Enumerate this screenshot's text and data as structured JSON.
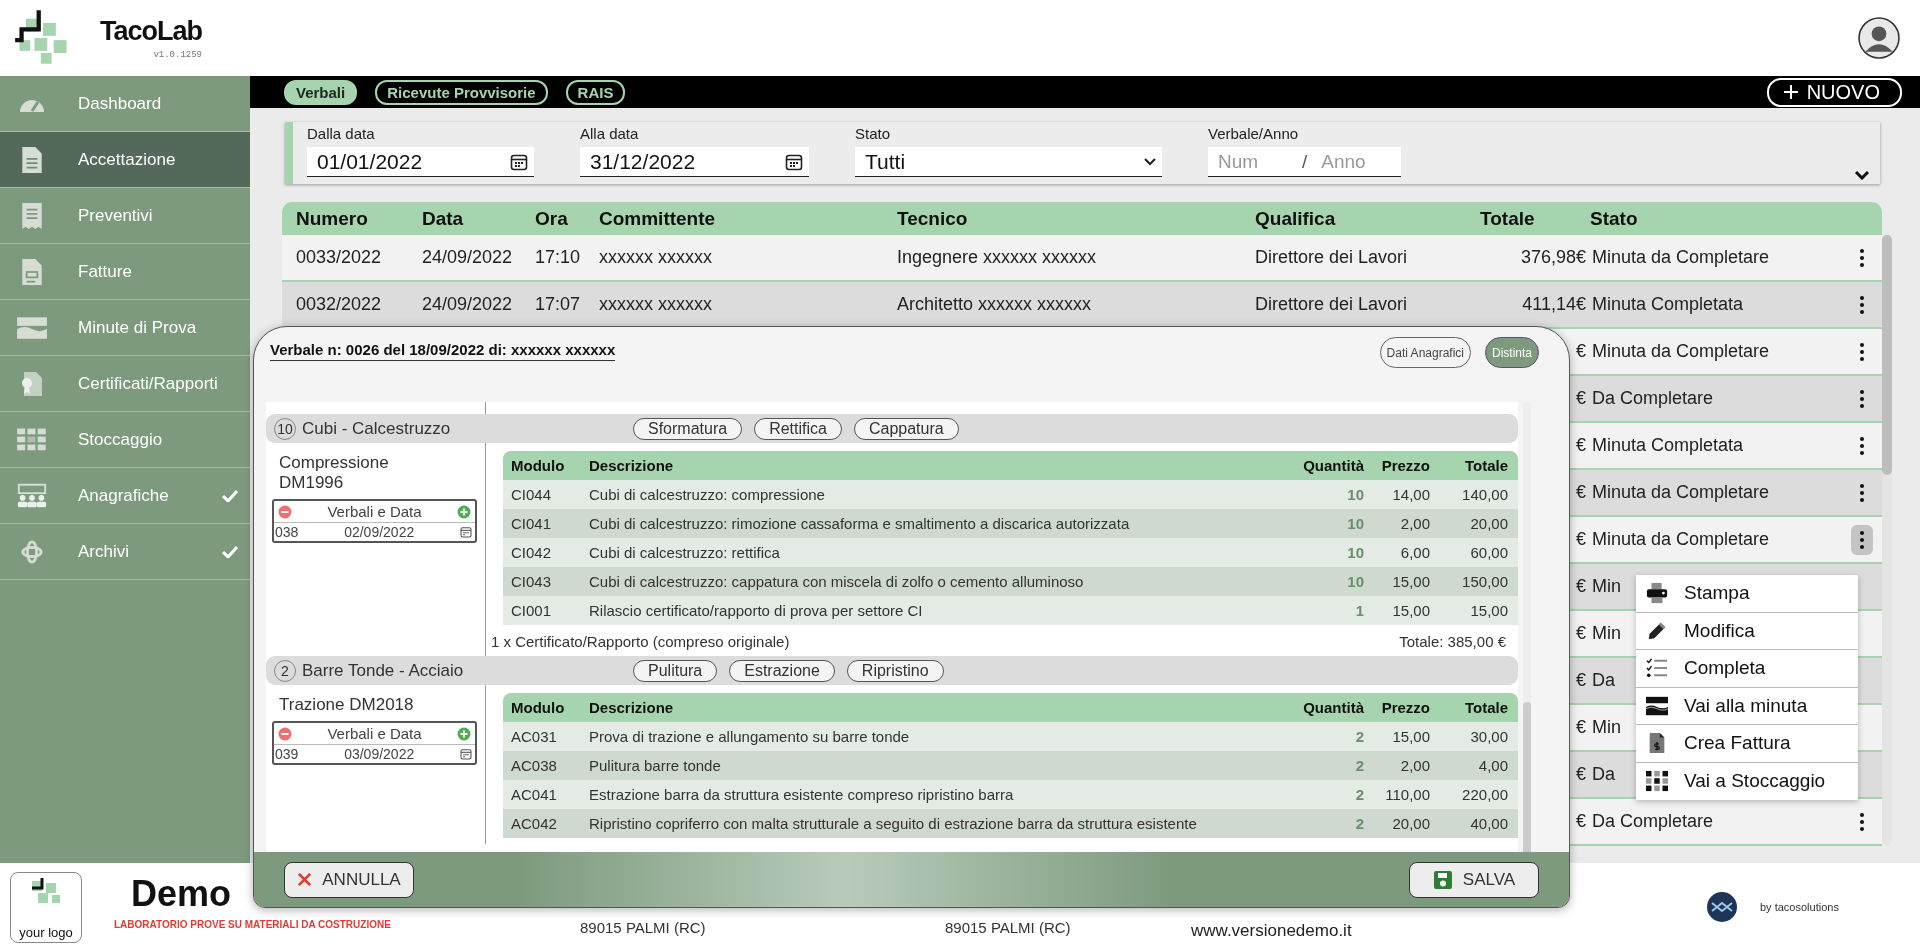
{
  "app": {
    "name": "TacoLab",
    "version": "v1.0.1259"
  },
  "sidebar": {
    "items": [
      {
        "label": "Dashboard",
        "kind": "gauge",
        "selected": false,
        "expandable": false
      },
      {
        "label": "Accettazione",
        "kind": "document",
        "selected": true,
        "expandable": false
      },
      {
        "label": "Preventivi",
        "kind": "receipt",
        "selected": false,
        "expandable": false
      },
      {
        "label": "Fatture",
        "kind": "invoice",
        "selected": false,
        "expandable": false
      },
      {
        "label": "Minute di Prova",
        "kind": "layers",
        "selected": false,
        "expandable": false
      },
      {
        "label": "Certificati/Rapporti",
        "kind": "certificate",
        "selected": false,
        "expandable": false
      },
      {
        "label": "Stoccaggio",
        "kind": "grid",
        "selected": false,
        "expandable": false
      },
      {
        "label": "Anagrafiche",
        "kind": "people",
        "selected": false,
        "expandable": true
      },
      {
        "label": "Archivi",
        "kind": "atom",
        "selected": false,
        "expandable": true
      }
    ]
  },
  "tabs": [
    {
      "label": "Verbali",
      "selected": true
    },
    {
      "label": "Ricevute Provvisorie",
      "selected": false
    },
    {
      "label": "RAIS",
      "selected": false
    }
  ],
  "new_button": {
    "label": "NUOVO"
  },
  "filters": {
    "date_from": {
      "label": "Dalla data",
      "value": "01/01/2022"
    },
    "date_to": {
      "label": "Alla data",
      "value": "31/12/2022"
    },
    "status": {
      "label": "Stato",
      "value": "Tutti"
    },
    "verbale": {
      "label": "Verbale/Anno",
      "num_placeholder": "Num",
      "separator": "/",
      "year_placeholder": "Anno"
    }
  },
  "table": {
    "columns": [
      "Numero",
      "Data",
      "Ora",
      "Committente",
      "Tecnico",
      "Qualifica",
      "Totale",
      "Stato"
    ],
    "rows": [
      {
        "numero": "0033/2022",
        "data": "24/09/2022",
        "ora": "17:10",
        "committente": "xxxxxx xxxxxx",
        "tecnico": "Ingegnere xxxxxx xxxxxx",
        "qualifica": "Direttore dei Lavori",
        "totale": "376,98€",
        "stato": "Minuta da Completare",
        "menu_open": false
      },
      {
        "numero": "0032/2022",
        "data": "24/09/2022",
        "ora": "17:07",
        "committente": "xxxxxx xxxxxx",
        "tecnico": "Architetto xxxxxx xxxxxx",
        "qualifica": "Direttore dei Lavori",
        "totale": "411,14€",
        "stato": "Minuta Completata",
        "menu_open": false
      },
      {
        "totale": "€",
        "stato": "Minuta da Completare",
        "menu_open": false
      },
      {
        "totale": "€",
        "stato": "Da Completare",
        "menu_open": false
      },
      {
        "totale": "€",
        "stato": "Minuta Completata",
        "menu_open": false
      },
      {
        "totale": "€",
        "stato": "Minuta da Completare",
        "menu_open": false
      },
      {
        "totale": "€",
        "stato": "Minuta da Completare",
        "menu_open": true
      },
      {
        "totale": "€",
        "stato": "Min",
        "menu_open": false
      },
      {
        "totale": "€",
        "stato": "Min",
        "menu_open": false
      },
      {
        "totale": "€",
        "stato": "Da",
        "menu_open": false
      },
      {
        "totale": "€",
        "stato": "Min",
        "menu_open": false
      },
      {
        "totale": "€",
        "stato": "Da",
        "menu_open": false
      },
      {
        "totale": "€",
        "stato": "Da Completare",
        "menu_open": false
      }
    ]
  },
  "context_menu": {
    "items": [
      {
        "label": "Stampa",
        "kind": "print"
      },
      {
        "label": "Modifica",
        "kind": "edit"
      },
      {
        "label": "Completa",
        "kind": "checklist"
      },
      {
        "label": "Vai alla minuta",
        "kind": "layers"
      },
      {
        "label": "Crea Fattura",
        "kind": "invoice"
      },
      {
        "label": "Vai a Stoccaggio",
        "kind": "grid"
      }
    ]
  },
  "modal": {
    "title": "Verbale n: 0026 del 18/09/2022 di: xxxxxx xxxxxx",
    "tabs": [
      {
        "label": "Dati Anagrafici",
        "selected": false
      },
      {
        "label": "Distinta",
        "selected": true
      }
    ],
    "groups": [
      {
        "count": "10",
        "name": "Cubi - Calcestruzzo",
        "operations": [
          "Sformatura",
          "Rettifica",
          "Cappatura"
        ],
        "test": "Compressione DM1996",
        "verbali": {
          "title": "Verbali e Data",
          "number": "038",
          "date": "02/09/2022"
        },
        "columns": [
          "Modulo",
          "Descrizione",
          "Quantità",
          "Prezzo",
          "Totale"
        ],
        "rows": [
          {
            "modulo": "CI044",
            "descrizione": "Cubi di calcestruzzo: compressione",
            "quantita": "10",
            "prezzo": "14,00",
            "totale": "140,00"
          },
          {
            "modulo": "CI041",
            "descrizione": "Cubi di calcestruzzo: rimozione cassaforma e smaltimento a discarica autorizzata",
            "quantita": "10",
            "prezzo": "2,00",
            "totale": "20,00"
          },
          {
            "modulo": "CI042",
            "descrizione": "Cubi di calcestruzzo: rettifica",
            "quantita": "10",
            "prezzo": "6,00",
            "totale": "60,00"
          },
          {
            "modulo": "CI043",
            "descrizione": "Cubi di calcestruzzo: cappatura con miscela di zolfo o cemento alluminoso",
            "quantita": "10",
            "prezzo": "15,00",
            "totale": "150,00"
          },
          {
            "modulo": "CI001",
            "descrizione": "Rilascio certificato/rapporto di prova per settore CI",
            "quantita": "1",
            "prezzo": "15,00",
            "totale": "15,00"
          }
        ],
        "summary": "1 x Certificato/Rapporto (compreso originale)",
        "total": "Totale: 385,00 €"
      },
      {
        "count": "2",
        "name": "Barre Tonde - Acciaio",
        "operations": [
          "Pulitura",
          "Estrazione",
          "Ripristino"
        ],
        "test": "Trazione DM2018",
        "verbali": {
          "title": "Verbali e Data",
          "number": "039",
          "date": "03/09/2022"
        },
        "columns": [
          "Modulo",
          "Descrizione",
          "Quantità",
          "Prezzo",
          "Totale"
        ],
        "rows": [
          {
            "modulo": "AC031",
            "descrizione": "Prova di trazione e allungamento su barre tonde",
            "quantita": "2",
            "prezzo": "15,00",
            "totale": "30,00"
          },
          {
            "modulo": "AC038",
            "descrizione": "Pulitura barre tonde",
            "quantita": "2",
            "prezzo": "2,00",
            "totale": "4,00"
          },
          {
            "modulo": "AC041",
            "descrizione": "Estrazione barra da struttura esistente compreso ripristino barra",
            "quantita": "2",
            "prezzo": "110,00",
            "totale": "220,00"
          },
          {
            "modulo": "AC042",
            "descrizione": "Ripristino copriferro con malta strutturale a seguito di estrazione barra da struttura esistente",
            "quantita": "2",
            "prezzo": "20,00",
            "totale": "40,00"
          }
        ]
      }
    ],
    "cancel": "ANNULLA",
    "save": "SALVA"
  },
  "footer": {
    "logo_text": "your logo",
    "company": "Demo",
    "subtitle": "LABORATORIO PROVE SU MATERIALI DA COSTRUZIONE",
    "address_1": "89015 PALMI (RC)",
    "address_2": "89015 PALMI (RC)",
    "website": "www.versionedemo.it",
    "credit": "by tacosolutions"
  }
}
